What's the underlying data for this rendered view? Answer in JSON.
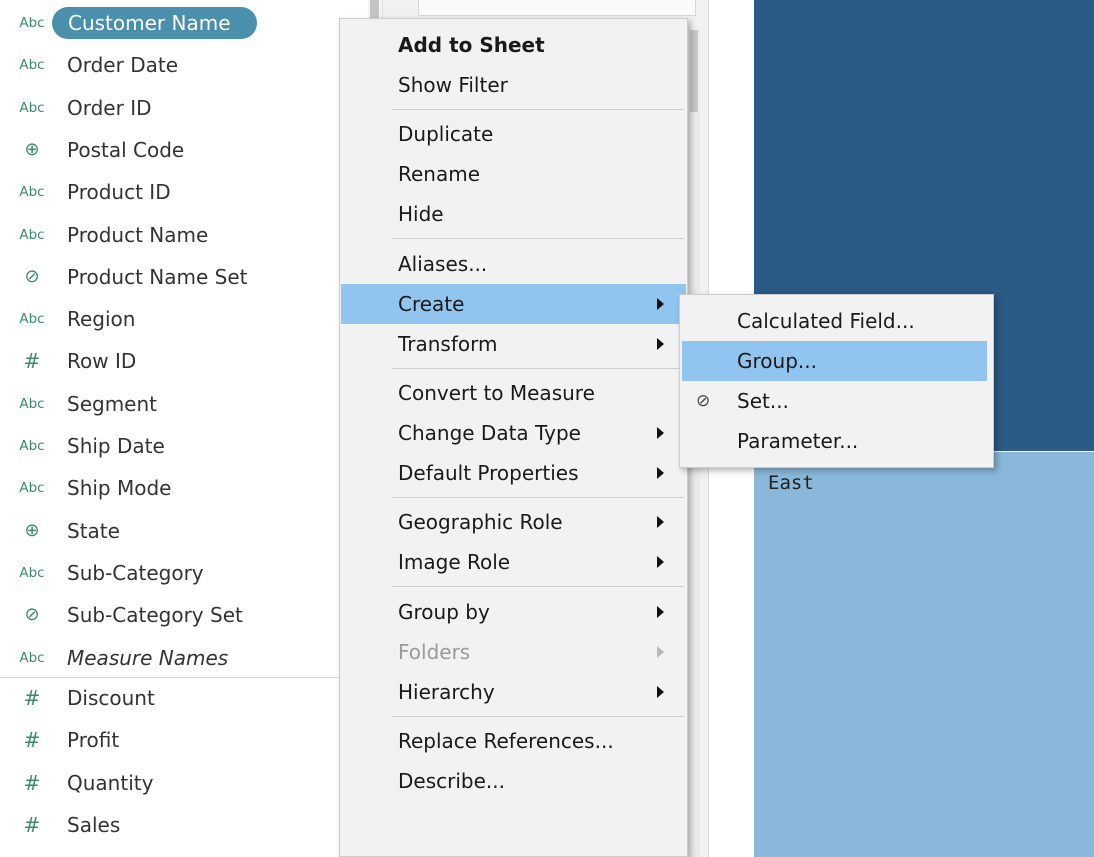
{
  "fields": {
    "dimensions": [
      {
        "type_icon": "Abc",
        "icon": "abc-string-icon",
        "label": "Customer Name",
        "selected": true
      },
      {
        "type_icon": "Abc",
        "icon": "abc-string-icon",
        "label": "Order Date"
      },
      {
        "type_icon": "Abc",
        "icon": "abc-string-icon",
        "label": "Order ID"
      },
      {
        "type_icon": "⊕",
        "icon": "globe-icon",
        "label": "Postal Code"
      },
      {
        "type_icon": "Abc",
        "icon": "abc-string-icon",
        "label": "Product ID"
      },
      {
        "type_icon": "Abc",
        "icon": "abc-string-icon",
        "label": "Product Name"
      },
      {
        "type_icon": "⊘",
        "icon": "set-icon",
        "label": "Product Name Set"
      },
      {
        "type_icon": "Abc",
        "icon": "abc-string-icon",
        "label": "Region"
      },
      {
        "type_icon": "#",
        "icon": "number-icon",
        "label": "Row ID"
      },
      {
        "type_icon": "Abc",
        "icon": "abc-string-icon",
        "label": "Segment"
      },
      {
        "type_icon": "Abc",
        "icon": "abc-string-icon",
        "label": "Ship Date"
      },
      {
        "type_icon": "Abc",
        "icon": "abc-string-icon",
        "label": "Ship Mode"
      },
      {
        "type_icon": "⊕",
        "icon": "globe-icon",
        "label": "State"
      },
      {
        "type_icon": "Abc",
        "icon": "abc-string-icon",
        "label": "Sub-Category"
      },
      {
        "type_icon": "⊘",
        "icon": "set-icon",
        "label": "Sub-Category Set"
      },
      {
        "type_icon": "Abc",
        "icon": "abc-string-icon",
        "label": "Measure Names",
        "italic": true
      }
    ],
    "measures": [
      {
        "type_icon": "#",
        "icon": "number-icon",
        "label": "Discount"
      },
      {
        "type_icon": "#",
        "icon": "number-icon",
        "label": "Profit"
      },
      {
        "type_icon": "#",
        "icon": "number-icon",
        "label": "Quantity"
      },
      {
        "type_icon": "#",
        "icon": "number-icon",
        "label": "Sales"
      }
    ]
  },
  "context_menu": {
    "items": [
      {
        "label": "Add to Sheet",
        "bold": true
      },
      {
        "label": "Show Filter"
      },
      {
        "separator": true
      },
      {
        "label": "Duplicate"
      },
      {
        "label": "Rename"
      },
      {
        "label": "Hide"
      },
      {
        "separator": true
      },
      {
        "label": "Aliases..."
      },
      {
        "label": "Create",
        "submenu": true,
        "highlighted": true
      },
      {
        "label": "Transform",
        "submenu": true
      },
      {
        "separator": true
      },
      {
        "label": "Convert to Measure"
      },
      {
        "label": "Change Data Type",
        "submenu": true
      },
      {
        "label": "Default Properties",
        "submenu": true
      },
      {
        "separator": true
      },
      {
        "label": "Geographic Role",
        "submenu": true
      },
      {
        "label": "Image Role",
        "submenu": true
      },
      {
        "separator": true
      },
      {
        "label": "Group by",
        "submenu": true
      },
      {
        "label": "Folders",
        "submenu": true,
        "disabled": true
      },
      {
        "label": "Hierarchy",
        "submenu": true
      },
      {
        "separator": true
      },
      {
        "label": "Replace References..."
      },
      {
        "label": "Describe..."
      }
    ]
  },
  "create_submenu": {
    "items": [
      {
        "label": "Calculated Field..."
      },
      {
        "label": "Group...",
        "highlighted": true
      },
      {
        "label": "Set...",
        "icon": "set-icon",
        "icon_glyph": "⊘"
      },
      {
        "label": "Parameter..."
      }
    ]
  },
  "view": {
    "light_region_label": "East",
    "colors": {
      "dark_region": "#2c5a86",
      "light_region": "#8ab8da",
      "menu_highlight": "#91c4ef",
      "selected_pill": "#4a8fab"
    }
  }
}
